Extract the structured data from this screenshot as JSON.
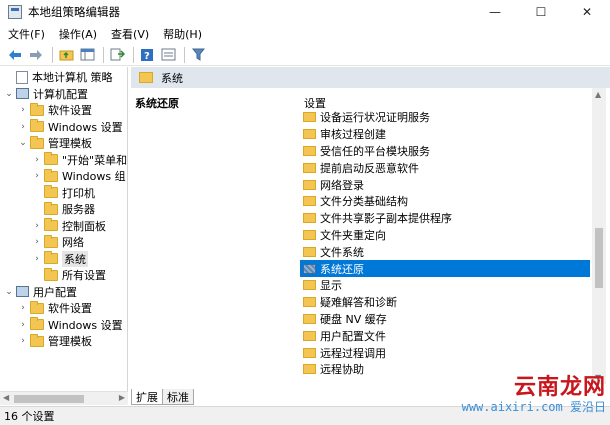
{
  "window": {
    "title": "本地组策略编辑器",
    "minimize": "—",
    "maximize": "☐",
    "close": "✕"
  },
  "menu": [
    "文件(F)",
    "操作(A)",
    "查看(V)",
    "帮助(H)"
  ],
  "toolbar": {
    "icons": [
      "back-arrow-icon",
      "forward-arrow-icon",
      "up-folder-icon",
      "show-hide-tree-icon",
      "export-list-icon",
      "help-icon",
      "properties-icon",
      "filter-icon"
    ]
  },
  "tree": {
    "items": [
      {
        "label": "本地计算机 策略",
        "depth": 0,
        "expander": "",
        "icon": "doc"
      },
      {
        "label": "计算机配置",
        "depth": 0,
        "expander": "⌄",
        "icon": "computer"
      },
      {
        "label": "软件设置",
        "depth": 1,
        "expander": "›",
        "icon": "folder"
      },
      {
        "label": "Windows 设置",
        "depth": 1,
        "expander": "›",
        "icon": "folder"
      },
      {
        "label": "管理模板",
        "depth": 1,
        "expander": "⌄",
        "icon": "folder"
      },
      {
        "label": "\"开始\"菜单和",
        "depth": 2,
        "expander": "›",
        "icon": "folder"
      },
      {
        "label": "Windows 组",
        "depth": 2,
        "expander": "›",
        "icon": "folder"
      },
      {
        "label": "打印机",
        "depth": 2,
        "expander": "",
        "icon": "folder"
      },
      {
        "label": "服务器",
        "depth": 2,
        "expander": "",
        "icon": "folder"
      },
      {
        "label": "控制面板",
        "depth": 2,
        "expander": "›",
        "icon": "folder"
      },
      {
        "label": "网络",
        "depth": 2,
        "expander": "›",
        "icon": "folder"
      },
      {
        "label": "系统",
        "depth": 2,
        "expander": "›",
        "icon": "folder",
        "selected": true
      },
      {
        "label": "所有设置",
        "depth": 2,
        "expander": "",
        "icon": "folder"
      },
      {
        "label": "用户配置",
        "depth": 0,
        "expander": "⌄",
        "icon": "computer"
      },
      {
        "label": "软件设置",
        "depth": 1,
        "expander": "›",
        "icon": "folder"
      },
      {
        "label": "Windows 设置",
        "depth": 1,
        "expander": "›",
        "icon": "folder"
      },
      {
        "label": "管理模板",
        "depth": 1,
        "expander": "›",
        "icon": "folder"
      }
    ]
  },
  "content": {
    "header_title": "系统",
    "description_title": "系统还原",
    "column_header": "设置",
    "items": [
      {
        "name": "设备运行状况证明服务",
        "icon": "folder"
      },
      {
        "name": "审核过程创建",
        "icon": "folder"
      },
      {
        "name": "受信任的平台模块服务",
        "icon": "folder"
      },
      {
        "name": "提前启动反恶意软件",
        "icon": "folder"
      },
      {
        "name": "网络登录",
        "icon": "folder"
      },
      {
        "name": "文件分类基础结构",
        "icon": "folder"
      },
      {
        "name": "文件共享影子副本提供程序",
        "icon": "folder"
      },
      {
        "name": "文件夹重定向",
        "icon": "folder"
      },
      {
        "name": "文件系统",
        "icon": "folder"
      },
      {
        "name": "系统还原",
        "icon": "setting",
        "selected": true
      },
      {
        "name": "显示",
        "icon": "folder"
      },
      {
        "name": "疑难解答和诊断",
        "icon": "folder"
      },
      {
        "name": "硬盘 NV 缓存",
        "icon": "folder"
      },
      {
        "name": "用户配置文件",
        "icon": "folder"
      },
      {
        "name": "远程过程调用",
        "icon": "folder"
      },
      {
        "name": "远程协助",
        "icon": "folder"
      }
    ]
  },
  "tabs": [
    "扩展",
    "标准"
  ],
  "status": "16 个设置",
  "watermark": {
    "main": "云南龙网",
    "sub": "www.aixiri.com",
    "corner": "爱沿日"
  },
  "colors": {
    "selection": "#0078d7",
    "header": "#dfe6ee",
    "folder": "#f3c654",
    "watermark_red": "#c8161d",
    "watermark_blue": "#3a8fd6"
  }
}
